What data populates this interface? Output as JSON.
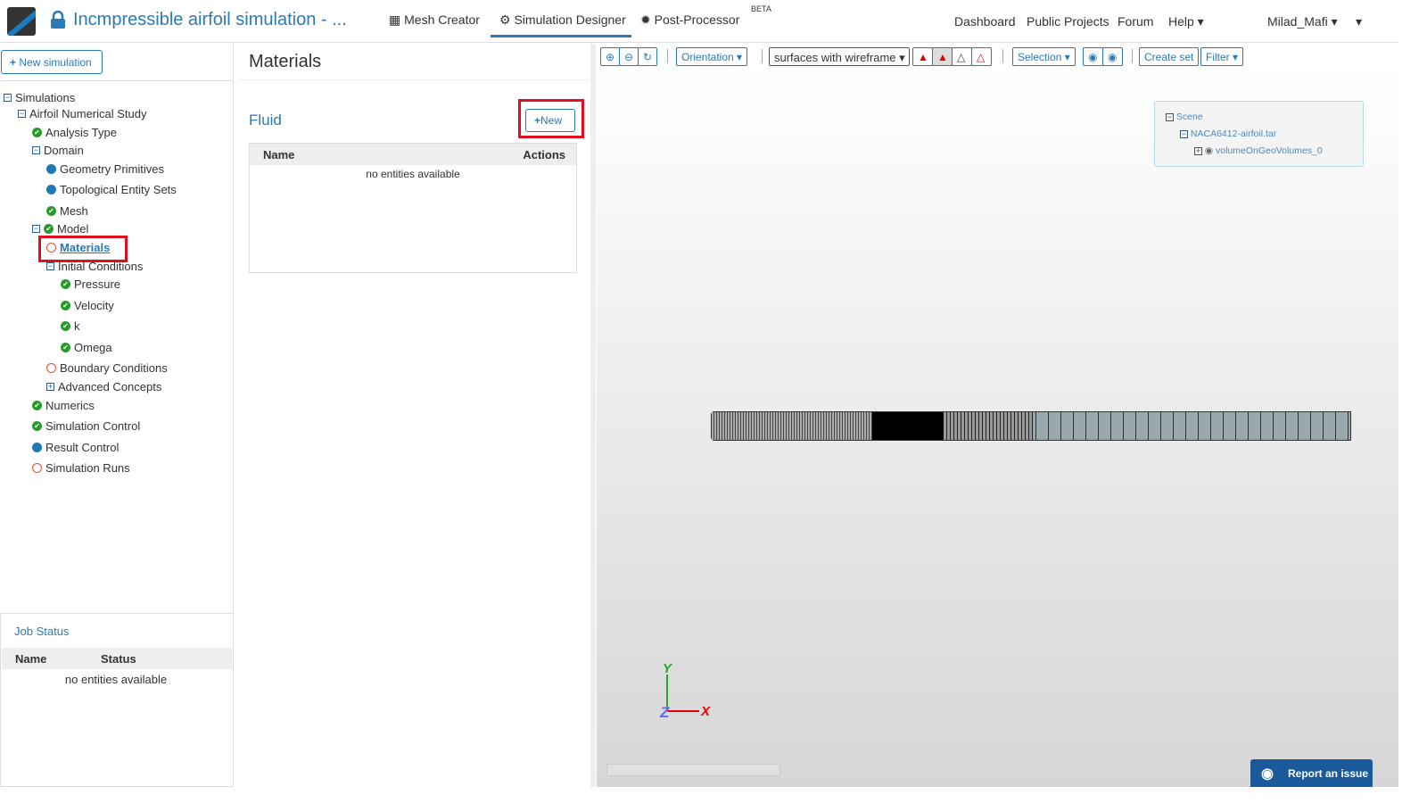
{
  "header": {
    "title": "Incmpressible airfoil simulation - ...",
    "nav": [
      {
        "label": "Mesh Creator"
      },
      {
        "label": "Simulation Designer"
      },
      {
        "label": "Post-Processor"
      }
    ],
    "beta": "BETA",
    "right": [
      "Dashboard",
      "Public Projects",
      "Forum",
      "Help",
      "Milad_Mafi"
    ]
  },
  "sidebar": {
    "new_sim": "New simulation",
    "tree": [
      "Simulations",
      "Airfoil Numerical Study",
      "Analysis Type",
      "Domain",
      "Geometry Primitives",
      "Topological Entity Sets",
      "Mesh",
      "Model",
      "Materials",
      "Initial Conditions",
      "Pressure",
      "Velocity",
      "k",
      "Omega",
      "Boundary Conditions",
      "Advanced Concepts",
      "Numerics",
      "Simulation Control",
      "Result Control",
      "Simulation Runs"
    ]
  },
  "job": {
    "title": "Job Status",
    "cols": [
      "Name",
      "Status"
    ],
    "empty": "no entities available"
  },
  "main": {
    "title": "Materials",
    "section": "Fluid",
    "new": "New",
    "cols": [
      "Name",
      "Actions"
    ],
    "empty": "no entities available"
  },
  "viewer": {
    "orientation": "Orientation",
    "render_mode": "surfaces with wireframe",
    "selection": "Selection",
    "create_set": "Create set",
    "filter": "Filter",
    "scene": [
      "Scene",
      "NACA6412-airfoil.tar",
      "volumeOnGeoVolumes_0"
    ],
    "report": "Report an issue",
    "axes": {
      "x": "X",
      "y": "Y",
      "z": "Z"
    }
  },
  "colors": {
    "accent": "#2a7ab8",
    "ok": "#2a9a2a",
    "pending": "#e0503a",
    "highlight": "#e0101e"
  }
}
